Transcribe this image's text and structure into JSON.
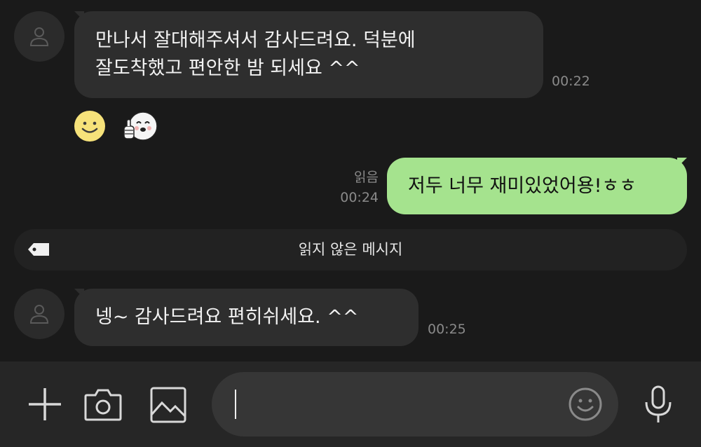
{
  "messages": [
    {
      "direction": "incoming",
      "lines": [
        "만나서 잘대해주셔서 감사드려요. 덕분에",
        "잘도착했고 편안한 밤 되세요 ^^"
      ],
      "time": "00:22"
    },
    {
      "direction": "outgoing",
      "text": "저두 너무 재미있었어용!ㅎㅎ",
      "read_label": "읽음",
      "time": "00:24"
    },
    {
      "direction": "incoming",
      "text": "넹~  감사드려요  편히쉬세요. ^^",
      "time": "00:25"
    }
  ],
  "emoticons": [
    "smiley-emoji",
    "thumbs-up-character-emoji"
  ],
  "unread_divider": {
    "label": "읽지 않은 메시지",
    "icon": "tag-icon"
  },
  "input_bar": {
    "icons": [
      "plus-icon",
      "camera-icon",
      "gallery-icon",
      "emoji-icon",
      "microphone-icon"
    ],
    "message_value": ""
  },
  "colors": {
    "background": "#1a1a1a",
    "incoming_bubble": "#2e2e2e",
    "outgoing_bubble": "#a5e38e",
    "input_bar": "#262626"
  }
}
